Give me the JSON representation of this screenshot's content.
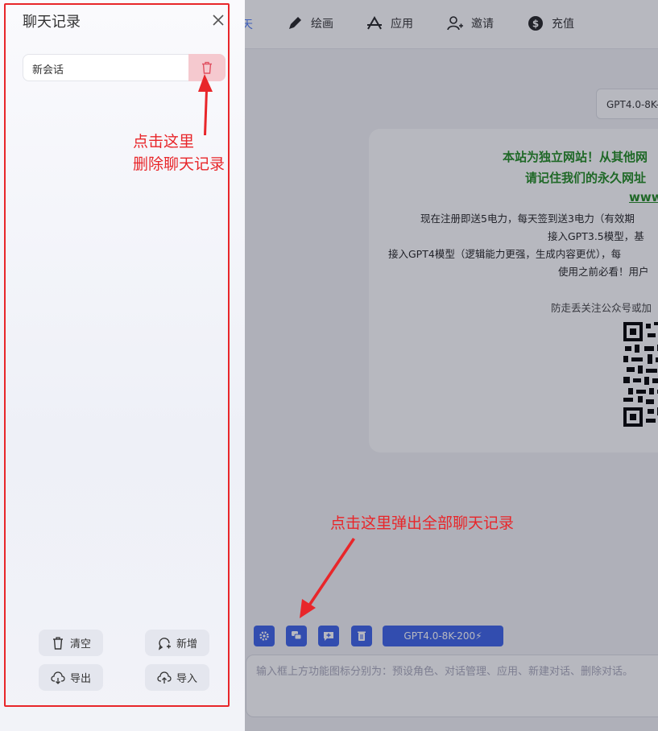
{
  "nav": {
    "active_label": "天",
    "items": [
      {
        "label": "绘画",
        "icon": "pencil-icon"
      },
      {
        "label": "应用",
        "icon": "app-icon"
      },
      {
        "label": "邀请",
        "icon": "add-user-icon"
      },
      {
        "label": "充值",
        "icon": "dollar-icon"
      }
    ]
  },
  "model_select": "GPT4.0-8K-",
  "notice": {
    "line1": "本站为独立网站！从其他网",
    "line2": "请记住我们的永久网址",
    "line3": "www",
    "line4": "现在注册即送5电力，每天签到送3电力（有效期",
    "line5": "接入GPT3.5模型，基",
    "line6": "接入GPT4模型（逻辑能力更强，生成内容更优），每",
    "line7": "使用之前必看！用户",
    "line8": "防走丢关注公众号或加"
  },
  "toolbar": {
    "buttons": [
      "gear-icon",
      "chat-history-icon",
      "new-chat-icon",
      "trash-icon"
    ],
    "model_chip": "GPT4.0-8K-200⚡"
  },
  "chat_input": {
    "placeholder": "输入框上方功能图标分别为：预设角色、对话管理、应用、新建对话、删除对话。"
  },
  "drawer": {
    "title": "聊天记录",
    "session_label": "新会话",
    "buttons": {
      "clear": "清空",
      "add": "新增",
      "export": "导出",
      "import": "导入"
    }
  },
  "annotations": {
    "delete_line1": "点击这里",
    "delete_line2": "删除聊天记录",
    "history_hint": "点击这里弹出全部聊天记录"
  },
  "colors": {
    "annotation_red": "#e8262a",
    "primary_blue": "#3b62e8",
    "notice_green": "#1f8a1f",
    "delete_pink": "#f5c9cf"
  }
}
